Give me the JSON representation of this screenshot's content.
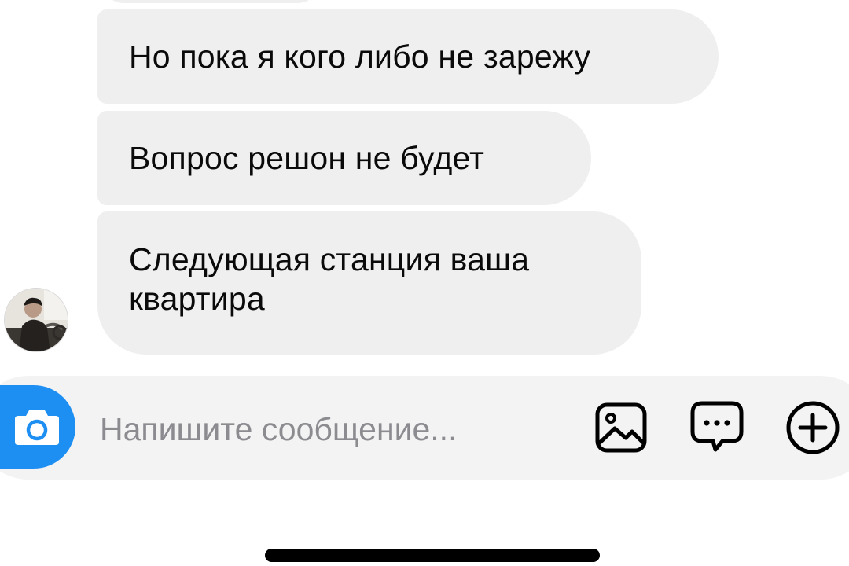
{
  "messages": [
    {
      "text": "Но пока я кого либо не зарежу"
    },
    {
      "text": "Вопрос решон не будет"
    },
    {
      "text": "Следующая станция ваша\nквартира"
    }
  ],
  "composer": {
    "placeholder": "Напишите сообщение...",
    "value": ""
  },
  "icons": {
    "camera": "camera-icon",
    "gallery": "image-gallery-icon",
    "sticker": "chat-bubble-ellipsis-icon",
    "plus": "plus-circle-icon"
  },
  "colors": {
    "accent": "#1e8ff2",
    "bubble": "#efeff0",
    "composer_background": "#f3f3f4",
    "placeholder": "#8b8b90"
  }
}
